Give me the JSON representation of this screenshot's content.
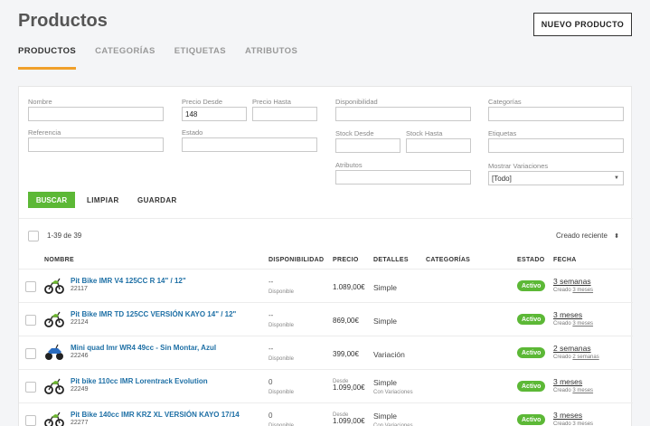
{
  "header": {
    "title": "Productos",
    "new_product_label": "NUEVO PRODUCTO"
  },
  "tabs": [
    {
      "label": "PRODUCTOS",
      "active": true
    },
    {
      "label": "CATEGORÍAS",
      "active": false
    },
    {
      "label": "ETIQUETAS",
      "active": false
    },
    {
      "label": "ATRIBUTOS",
      "active": false
    }
  ],
  "filters": {
    "nombre": {
      "label": "Nombre",
      "value": ""
    },
    "precio_desde": {
      "label": "Precio Desde",
      "value": "148"
    },
    "precio_hasta": {
      "label": "Precio Hasta",
      "value": ""
    },
    "disponibilidad": {
      "label": "Disponibilidad",
      "value": ""
    },
    "categorias": {
      "label": "Categorías",
      "value": ""
    },
    "referencia": {
      "label": "Referencia",
      "value": ""
    },
    "estado": {
      "label": "Estado",
      "value": ""
    },
    "stock_desde": {
      "label": "Stock Desde",
      "value": ""
    },
    "stock_hasta": {
      "label": "Stock Hasta",
      "value": ""
    },
    "etiquetas": {
      "label": "Etiquetas",
      "value": ""
    },
    "atributos": {
      "label": "Atributos",
      "value": ""
    },
    "mostrar_variaciones": {
      "label": "Mostrar Variaciones",
      "value": "[Todo]"
    }
  },
  "actions": {
    "search": "BUSCAR",
    "clear": "LIMPIAR",
    "save": "GUARDAR"
  },
  "list": {
    "count": "1-39 de 39",
    "sort": "Creado reciente",
    "columns": {
      "nombre": "NOMBRE",
      "disponibilidad": "DISPONIBILIDAD",
      "precio": "PRECIO",
      "detalles": "DETALLES",
      "categorias": "CATEGORÍAS",
      "estado": "ESTADO",
      "fecha": "FECHA"
    },
    "rows": [
      {
        "name": "Pit Bike IMR V4 125CC R 14\" / 12\"",
        "ref": "22117",
        "disp": "--",
        "disp_sub": "Disponible",
        "price_prefix": "",
        "price": "1.089,00€",
        "detail": "Simple",
        "detail_sub": "",
        "status": "Activo",
        "date": "3 semanas",
        "created_prefix": "Creado",
        "created": "3 meses",
        "thumb": "bike"
      },
      {
        "name": "Pit Bike IMR TD 125CC VERSIÓN KAYO 14\" / 12\"",
        "ref": "22124",
        "disp": "--",
        "disp_sub": "Disponible",
        "price_prefix": "",
        "price": "869,00€",
        "detail": "Simple",
        "detail_sub": "",
        "status": "Activo",
        "date": "3 meses",
        "created_prefix": "Creado",
        "created": "3 meses",
        "thumb": "bike"
      },
      {
        "name": "Mini quad Imr WR4 49cc - Sin Montar, Azul",
        "ref": "22246",
        "disp": "--",
        "disp_sub": "Disponible",
        "price_prefix": "",
        "price": "399,00€",
        "detail": "Variación",
        "detail_sub": "",
        "status": "Activo",
        "date": "2 semanas",
        "created_prefix": "Creado",
        "created": "2 semanas",
        "thumb": "quad"
      },
      {
        "name": "Pit bike 110cc IMR Lorentrack Evolution",
        "ref": "22249",
        "disp": "0",
        "disp_sub": "Disponible",
        "price_prefix": "Desde",
        "price": "1.099,00€",
        "detail": "Simple",
        "detail_sub": "Con Variaciones",
        "status": "Activo",
        "date": "3 meses",
        "created_prefix": "Creado",
        "created": "3 meses",
        "thumb": "bike"
      },
      {
        "name": "Pit Bike 140cc IMR KRZ XL VERSIÓN KAYO 17/14",
        "ref": "22277",
        "disp": "0",
        "disp_sub": "Disponible",
        "price_prefix": "Desde",
        "price": "1.099,00€",
        "detail": "Simple",
        "detail_sub": "Con Variaciones",
        "status": "Activo",
        "date": "3 meses",
        "created_prefix": "Creado",
        "created": "3 meses",
        "thumb": "bike"
      }
    ]
  },
  "colors": {
    "accent": "#f0a02a",
    "success": "#5cb836",
    "link": "#1d6fa5"
  }
}
